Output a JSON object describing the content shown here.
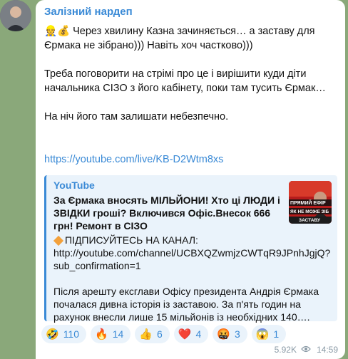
{
  "message": {
    "author": "Залізний нардеп",
    "paragraphs": [
      "👷💰 Через хвилину Казна зачиняється… а заставу для Єрмака не зібрано))) Навіть хоч частково)))",
      "Треба поговорити на стрімі про це і вирішити куди діти начальника СІЗО з його кабінету, поки там тусить Єрмак…",
      "На ніч його там залишати небезпечно."
    ],
    "link": "https://youtube.com/live/KB-D2Wtm8xs"
  },
  "preview": {
    "site": "YouTube",
    "title": "За Єрмака вносять МІЛЬЙОНИ! Хто ці ЛЮДИ і ЗВІДКИ гроші? Включився Офіс.Внесок 666 грн! Ремонт в СІЗО",
    "subscribe_line": "ПІДПИСУЙТЕСЬ НА КАНАЛ:",
    "channel_url": "http://youtube.com/channel/UCBXQZwmjzCWTqR9JPnhJgjQ?sub_confirmation=1",
    "desc_paragraph": "Після арешту ексглави Офісу президента Андрія Єрмака почалася дивна історія із заставою. За п'ять годин на рахунок внесли лише 15 мільйонів із необхідних 140…."
  },
  "thumbnail": {
    "text_top": "ПРЯМИЙ ЕФІР",
    "text_mid": "ЯК НЕ МОЖЕ ЗІБ",
    "text_bottom": "ЗАСТАВУ"
  },
  "reactions": [
    {
      "emoji": "🤣",
      "count": "110"
    },
    {
      "emoji": "🔥",
      "count": "14"
    },
    {
      "emoji": "👍",
      "count": "6"
    },
    {
      "emoji": "❤️",
      "count": "4"
    },
    {
      "emoji": "🤬",
      "count": "3"
    },
    {
      "emoji": "😱",
      "count": "1"
    }
  ],
  "meta": {
    "views": "5.92K",
    "time": "14:59"
  },
  "colors": {
    "accent": "#3a8ad6",
    "background": "#8aa87a"
  }
}
